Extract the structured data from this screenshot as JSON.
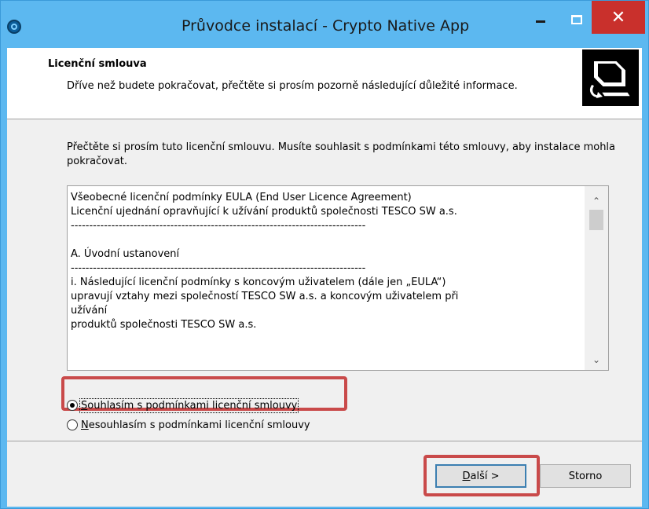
{
  "window": {
    "title": "Průvodce instalací - Crypto Native App",
    "minimize_glyph": "",
    "maximize_glyph": "",
    "close_glyph": "✕"
  },
  "header": {
    "title": "Licenční smlouva",
    "description": "Dříve než budete pokračovat, přečtěte si prosím pozorně následující důležité informace.",
    "image_icon": "setup-computer-icon"
  },
  "instructions": "Přečtěte si prosím tuto licenční smlouvu. Musíte souhlasit s podmínkami této smlouvy, aby instalace mohla pokračovat.",
  "license": {
    "text": "Všeobecné licenční podmínky EULA (End User Licence Agreement)\nLicenční ujednání opravňující k užívání produktů společnosti TESCO SW a.s.\n--------------------------------------------------------------------------------\n\nA. Úvodní ustanovení\n--------------------------------------------------------------------------------\ni. Následující licenční podmínky s koncovým uživatelem (dále jen „EULA“)\nupravují vztahy mezi společností TESCO SW a.s. a koncovým uživatelem při\nužívání\nproduktů společnosti TESCO SW a.s.",
    "scroll_up_glyph": "⌃",
    "scroll_down_glyph": "⌄"
  },
  "radios": {
    "accept": {
      "label_underlined": "S",
      "label_rest": "ouhlasím s podmínkami licenční smlouvy",
      "checked": true
    },
    "decline": {
      "label_underlined": "N",
      "label_rest": "esouhlasím s podmínkami licenční smlouvy",
      "checked": false
    }
  },
  "buttons": {
    "next": {
      "label_underlined": "D",
      "label_rest": "alší >"
    },
    "cancel": {
      "label": "Storno"
    }
  },
  "colors": {
    "titlebar": "#5cb8f0",
    "close_button": "#c9302c",
    "highlight": "#c94a4a"
  }
}
